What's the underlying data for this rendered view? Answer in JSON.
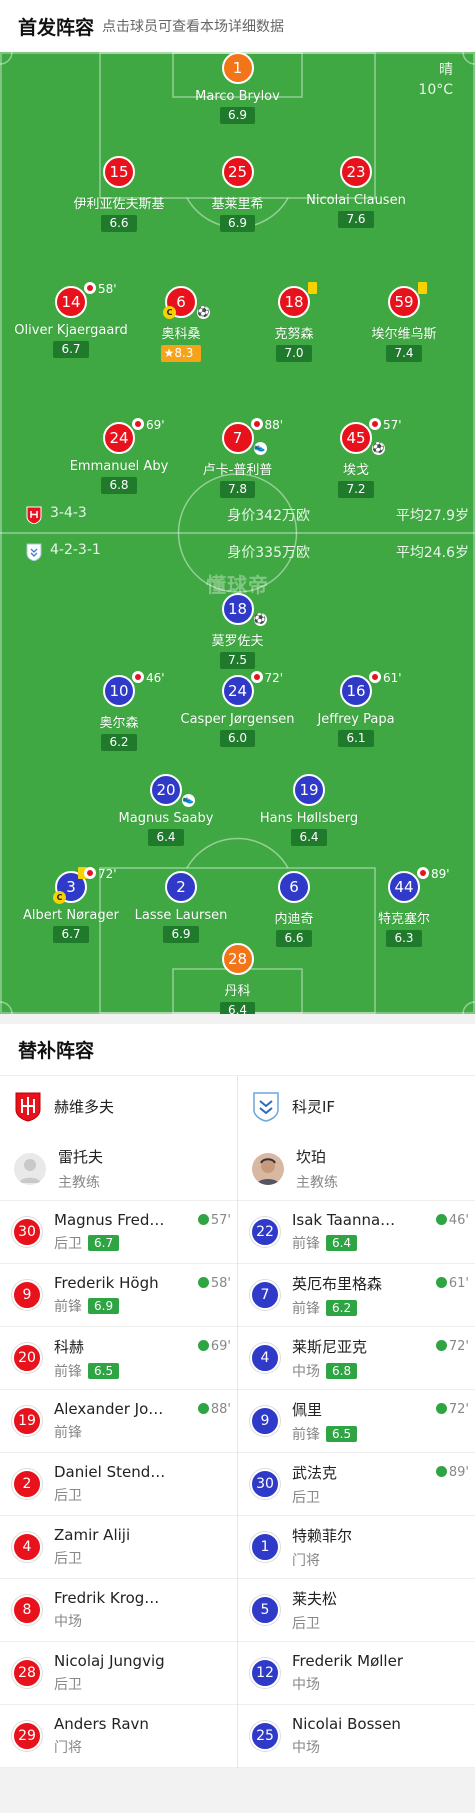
{
  "header": {
    "title": "首发阵容",
    "subtitle": "点击球员可查看本场详细数据"
  },
  "weather": {
    "condition": "晴",
    "temp": "10°C"
  },
  "home": {
    "formation": "3-4-3",
    "value": "身价342万欧",
    "age": "平均27.9岁"
  },
  "away": {
    "formation": "4-2-3-1",
    "value": "身价335万欧",
    "age": "平均24.6岁"
  },
  "watermark": "懂球帝",
  "pitch_players": [
    {
      "num": "1",
      "name": "Marco Brylov",
      "rating": "6.9"
    },
    {
      "num": "15",
      "name": "伊利亚佐夫斯基",
      "rating": "6.6"
    },
    {
      "num": "25",
      "name": "基莱里希",
      "rating": "6.9"
    },
    {
      "num": "23",
      "name": "Nicolai Clausen",
      "rating": "7.6"
    },
    {
      "num": "14",
      "name": "Oliver Kjaergaard",
      "rating": "6.7",
      "sub": "58'"
    },
    {
      "num": "6",
      "name": "奥科桑",
      "rating": "8.3"
    },
    {
      "num": "18",
      "name": "克努森",
      "rating": "7.0"
    },
    {
      "num": "59",
      "name": "埃尔维乌斯",
      "rating": "7.4"
    },
    {
      "num": "24",
      "name": "Emmanuel Aby",
      "rating": "6.8",
      "sub": "69'"
    },
    {
      "num": "7",
      "name": "卢卡-普利普",
      "rating": "7.8",
      "sub": "88'"
    },
    {
      "num": "45",
      "name": "埃戈",
      "rating": "7.2",
      "sub": "57'"
    },
    {
      "num": "18",
      "name": "莫罗佐夫",
      "rating": "7.5"
    },
    {
      "num": "10",
      "name": "奥尔森",
      "rating": "6.2",
      "sub": "46'"
    },
    {
      "num": "24",
      "name": "Casper Jørgensen",
      "rating": "6.0",
      "sub": "72'"
    },
    {
      "num": "16",
      "name": "Jeffrey Papa",
      "rating": "6.1",
      "sub": "61'"
    },
    {
      "num": "20",
      "name": "Magnus Saaby",
      "rating": "6.4"
    },
    {
      "num": "19",
      "name": "Hans Høllsberg",
      "rating": "6.4"
    },
    {
      "num": "3",
      "name": "Albert Nørager",
      "rating": "6.7",
      "sub": "72'"
    },
    {
      "num": "2",
      "name": "Lasse Laursen",
      "rating": "6.9"
    },
    {
      "num": "6",
      "name": "内迪奇",
      "rating": "6.6"
    },
    {
      "num": "44",
      "name": "特克塞尔",
      "rating": "6.3",
      "sub": "89'"
    },
    {
      "num": "28",
      "name": "丹科",
      "rating": "6.4"
    }
  ],
  "subs": {
    "title": "替补阵容",
    "home": {
      "team": "赫维多夫",
      "coach": "雷托夫",
      "coach_role": "主教练",
      "players": [
        {
          "num": "30",
          "name": "Magnus Fred…",
          "pos": "后卫",
          "rating": "6.7",
          "in": "57'"
        },
        {
          "num": "9",
          "name": "Frederik Högh",
          "pos": "前锋",
          "rating": "6.9",
          "in": "58'"
        },
        {
          "num": "20",
          "name": "科赫",
          "pos": "前锋",
          "rating": "6.5",
          "in": "69'"
        },
        {
          "num": "19",
          "name": "Alexander Jo…",
          "pos": "前锋",
          "rating": "",
          "in": "88'"
        },
        {
          "num": "2",
          "name": "Daniel Stende…",
          "pos": "后卫",
          "rating": "",
          "in": ""
        },
        {
          "num": "4",
          "name": "Zamir Aliji",
          "pos": "后卫",
          "rating": "",
          "in": ""
        },
        {
          "num": "8",
          "name": "Fredrik Krogs…",
          "pos": "中场",
          "rating": "",
          "in": ""
        },
        {
          "num": "28",
          "name": "Nicolaj Jungvig",
          "pos": "后卫",
          "rating": "",
          "in": ""
        },
        {
          "num": "29",
          "name": "Anders Ravn",
          "pos": "门将",
          "rating": "",
          "in": ""
        }
      ]
    },
    "away": {
      "team": "科灵IF",
      "coach": "坎珀",
      "coach_role": "主教练",
      "players": [
        {
          "num": "22",
          "name": "Isak Taannan…",
          "pos": "前锋",
          "rating": "6.4",
          "in": "46'"
        },
        {
          "num": "7",
          "name": "英厄布里格森",
          "pos": "前锋",
          "rating": "6.2",
          "in": "61'"
        },
        {
          "num": "4",
          "name": "莱斯尼亚克",
          "pos": "中场",
          "rating": "6.8",
          "in": "72'"
        },
        {
          "num": "9",
          "name": "佩里",
          "pos": "前锋",
          "rating": "6.5",
          "in": "72'"
        },
        {
          "num": "30",
          "name": "武法克",
          "pos": "后卫",
          "rating": "",
          "in": "89'"
        },
        {
          "num": "1",
          "name": "特赖菲尔",
          "pos": "门将",
          "rating": "",
          "in": ""
        },
        {
          "num": "5",
          "name": "莱夫松",
          "pos": "后卫",
          "rating": "",
          "in": ""
        },
        {
          "num": "12",
          "name": "Frederik Møller",
          "pos": "中场",
          "rating": "",
          "in": ""
        },
        {
          "num": "25",
          "name": "Nicolai Bossen",
          "pos": "中场",
          "rating": "",
          "in": ""
        }
      ]
    }
  },
  "colors": {
    "pitch": "#3fa842",
    "home": "#e8121c",
    "away": "#2f3bc8",
    "gk": "#f2751a",
    "rating": "#2ea443"
  }
}
